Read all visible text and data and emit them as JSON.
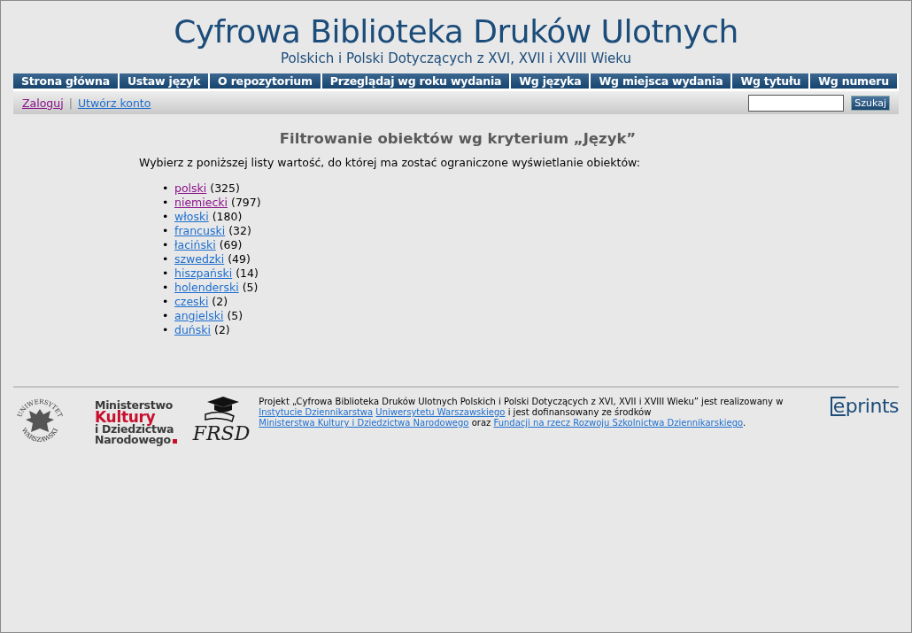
{
  "header": {
    "title": "Cyfrowa Biblioteka Druków Ulotnych",
    "subtitle": "Polskich i Polski Dotyczących z XVI, XVII i XVIII Wieku"
  },
  "nav": [
    "Strona główna",
    "Ustaw język",
    "O repozytorium",
    "Przeglądaj wg roku wydania",
    "Wg języka",
    "Wg miejsca wydania",
    "Wg tytułu",
    "Wg numeru"
  ],
  "user_bar": {
    "links": [
      {
        "label": "Zaloguj",
        "visited": true
      },
      {
        "label": "Utwórz konto",
        "visited": false
      }
    ],
    "separator": "|",
    "search_button": "Szukaj"
  },
  "heading": "Filtrowanie obiektów wg kryterium „Język”",
  "intro": "Wybierz z poniższej listy wartość, do której ma zostać ograniczone wyświetlanie obiektów:",
  "list_bullet": "•",
  "languages": [
    {
      "label": "polski",
      "count": "(325)",
      "visited": true
    },
    {
      "label": "niemiecki",
      "count": "(797)",
      "visited": true
    },
    {
      "label": "włoski",
      "count": "(180)",
      "visited": false
    },
    {
      "label": "francuski",
      "count": "(32)",
      "visited": false
    },
    {
      "label": "łaciński",
      "count": "(69)",
      "visited": false
    },
    {
      "label": "szwedzki",
      "count": "(49)",
      "visited": false
    },
    {
      "label": "hiszpański",
      "count": "(14)",
      "visited": false
    },
    {
      "label": "holenderski",
      "count": "(5)",
      "visited": false
    },
    {
      "label": "czeski",
      "count": "(2)",
      "visited": false
    },
    {
      "label": "angielski",
      "count": "(5)",
      "visited": false
    },
    {
      "label": "duński",
      "count": "(2)",
      "visited": false
    }
  ],
  "footer": {
    "university_logo": {
      "top": "UNIWERSYTET",
      "bottom": "WARSZAWSKI"
    },
    "ministry_logo": [
      "Ministerstwo",
      "Kultury",
      "i Dziedzictwa",
      "Narodowego"
    ],
    "frsd_logo": "FRSD",
    "text": [
      {
        "kind": "text",
        "text": "Projekt „Cyfrowa Biblioteka Druków Ulotnych Polskich i Polski Dotyczących z XVI, XVII i XVIII Wieku” jest realizowany w "
      },
      {
        "kind": "link",
        "text": "Instytucie Dziennikarstwa"
      },
      {
        "kind": "link",
        "text": "Uniwersytetu Warszawskiego"
      },
      {
        "kind": "text",
        "text": " i jest dofinansowany ze środków "
      },
      {
        "kind": "link",
        "text": "Ministerstwa Kultury i Dziedzictwa Narodowego"
      },
      {
        "kind": "text",
        "text": " oraz "
      },
      {
        "kind": "link",
        "text": "Fundacji na rzecz Rozwoju Szkolnictwa Dziennikarskiego"
      },
      {
        "kind": "text",
        "text": "."
      }
    ],
    "eprints_logo": {
      "boxed": "e",
      "rest": "prints"
    }
  }
}
